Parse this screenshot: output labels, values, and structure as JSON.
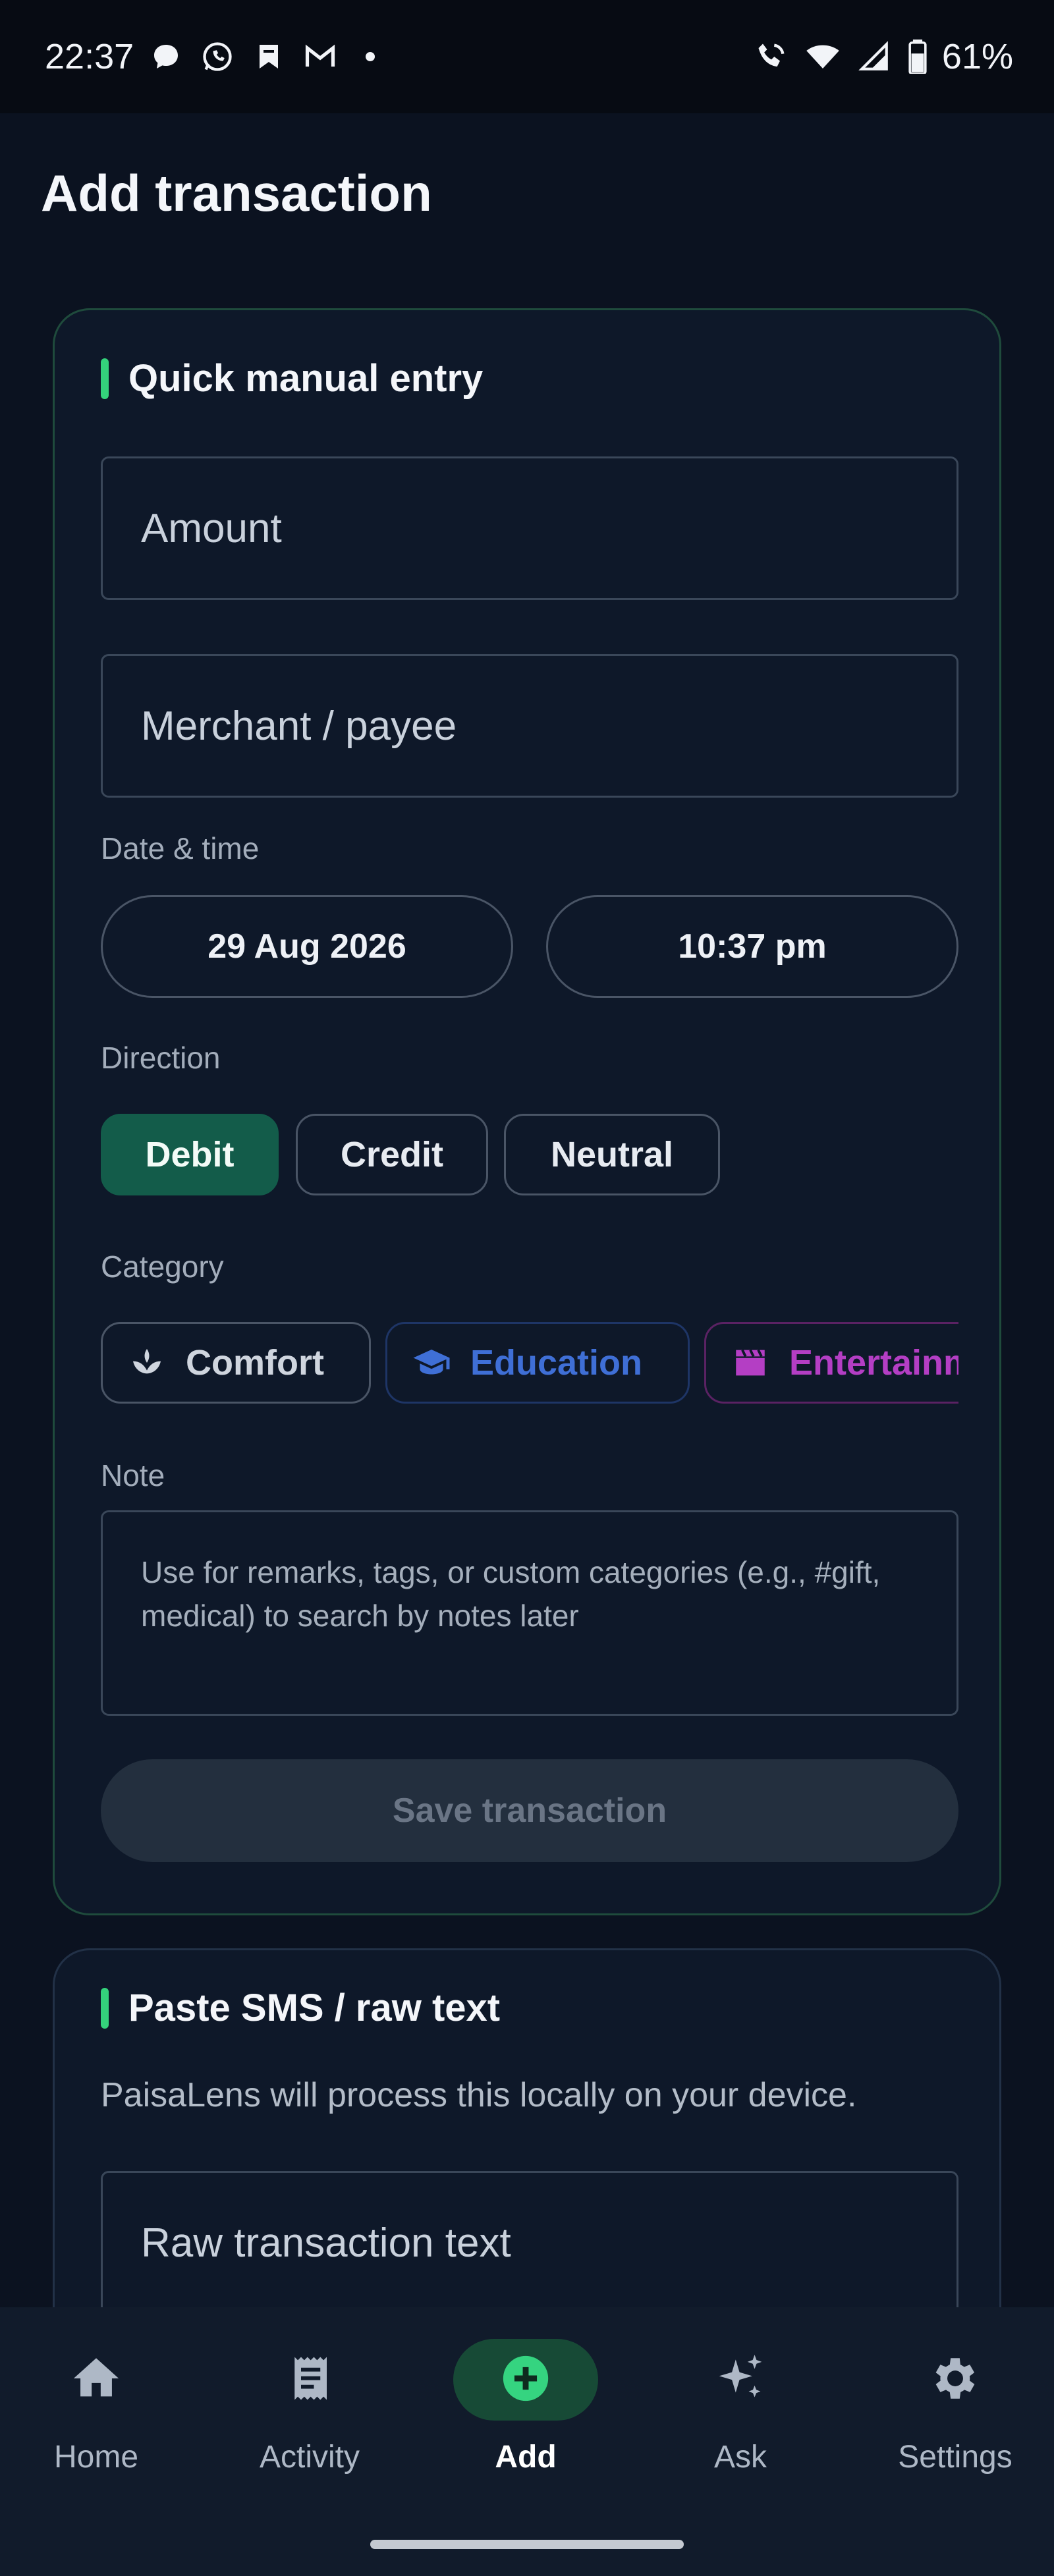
{
  "status_bar": {
    "time": "22:37",
    "battery": "61%",
    "left_icons": [
      "chat-bubble-icon",
      "whatsapp-icon",
      "bookmark-icon",
      "gmail-icon",
      "dot-icon"
    ],
    "right_icons": [
      "wifi-call-icon",
      "wifi-icon",
      "signal-icon",
      "battery-icon"
    ]
  },
  "page": {
    "title": "Add transaction"
  },
  "manual": {
    "heading": "Quick manual entry",
    "amount_placeholder": "Amount",
    "merchant_placeholder": "Merchant / payee",
    "datetime_label": "Date & time",
    "date": "29 Aug 2026",
    "time": "10:37 pm",
    "direction_label": "Direction",
    "directions": [
      {
        "label": "Debit",
        "active": true
      },
      {
        "label": "Credit",
        "active": false
      },
      {
        "label": "Neutral",
        "active": false
      }
    ],
    "category_label": "Category",
    "categories": [
      {
        "label": "Comfort",
        "icon": "lotus-icon",
        "color": "#cfd5de"
      },
      {
        "label": "Education",
        "icon": "graduation-cap-icon",
        "color": "#3f6fd6"
      },
      {
        "label": "Entertainment",
        "icon": "clapperboard-icon",
        "color": "#b43ec4"
      }
    ],
    "note_label": "Note",
    "note_placeholder": "Use for remarks, tags, or custom categories (e.g., #gift, medical) to search by notes later",
    "save_label": "Save transaction"
  },
  "paste": {
    "heading": "Paste SMS / raw text",
    "description": "PaisaLens will process this locally on your device.",
    "raw_placeholder": "Raw transaction text"
  },
  "nav": {
    "items": [
      {
        "label": "Home",
        "icon": "home-icon",
        "active": false
      },
      {
        "label": "Activity",
        "icon": "receipt-icon",
        "active": false
      },
      {
        "label": "Add",
        "icon": "add-icon",
        "active": true
      },
      {
        "label": "Ask",
        "icon": "sparkle-icon",
        "active": false
      },
      {
        "label": "Settings",
        "icon": "gear-icon",
        "active": false
      }
    ]
  },
  "colors": {
    "accent_green": "#34d27b",
    "active_chip": "#135c4a",
    "background": "#0b1220",
    "card": "#0e1829"
  }
}
